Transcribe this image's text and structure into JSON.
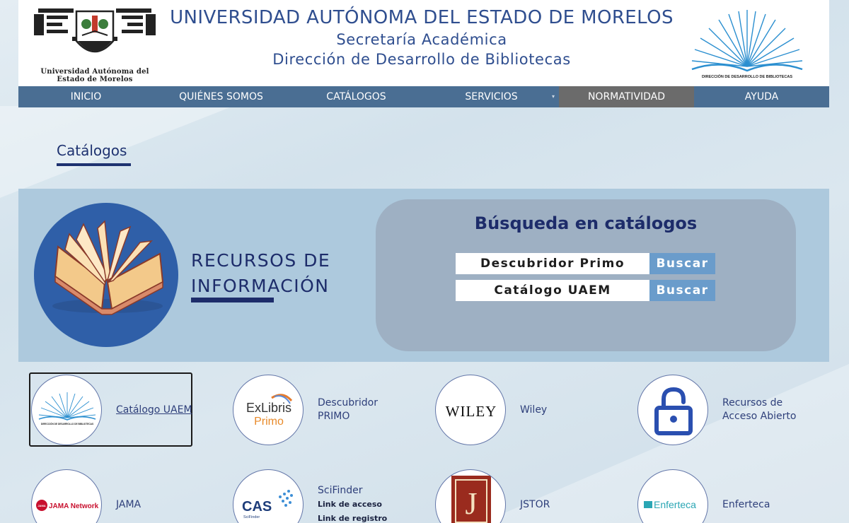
{
  "header": {
    "left_logo_text_line1": "Universidad Autónoma del",
    "left_logo_text_line2": "Estado de Morelos",
    "title": "UNIVERSIDAD AUTÓNOMA DEL ESTADO DE MORELOS",
    "subtitle1": "Secretaría Académica",
    "subtitle2": "Dirección de Desarrollo de Bibliotecas",
    "right_logo_text": "DIRECCIÓN DE DESARROLLO DE BIBLIOTECAS"
  },
  "nav": {
    "items": [
      {
        "label": "INICIO"
      },
      {
        "label": "QUIÉNES SOMOS"
      },
      {
        "label": "CATÁLOGOS"
      },
      {
        "label": "SERVICIOS"
      },
      {
        "label": "NORMATIVIDAD"
      },
      {
        "label": "AYUDA"
      }
    ],
    "active_index": 4,
    "caret": "▾"
  },
  "page": {
    "title": "Catálogos"
  },
  "banner": {
    "line1": "RECURSOS DE",
    "line2": "INFORMACIÓN",
    "search_title": "Búsqueda en catálogos",
    "rows": [
      {
        "field": "Descubridor Primo",
        "button": "Buscar"
      },
      {
        "field": "Catálogo UAEM",
        "button": "Buscar"
      }
    ]
  },
  "resources": {
    "catalogo": {
      "label": "Catálogo UAEM",
      "logo_text": "DIRECCIÓN DE DESARROLLO DE BIBLIOTECAS"
    },
    "primo": {
      "label1": "Descubridor",
      "label2": "PRIMO",
      "logo_line1": "ExLibris",
      "logo_line2": "Primo"
    },
    "wiley": {
      "label": "Wiley",
      "logo": "WILEY"
    },
    "abierto": {
      "label1": "Recursos de",
      "label2": "Acceso Abierto"
    },
    "jama": {
      "label": "JAMA",
      "logo": "JAMA Network",
      "logo_badge": "JAMA"
    },
    "scifinder": {
      "label": "SciFinder",
      "link1": "Link de acceso",
      "link2": "Link de registro",
      "logo": "CAS",
      "logo_sub": "SciFinder"
    },
    "jstor": {
      "label": "JSTOR",
      "logo_letter": "J"
    },
    "enferteca": {
      "label": "Enferteca",
      "logo": "Enferteca"
    }
  },
  "colors": {
    "nav_bg": "#4a6e93",
    "nav_active": "#6b6b6b",
    "banner_bg": "#adc9dd",
    "search_panel": "#9eb0c3",
    "button": "#6a9ccb",
    "title_blue": "#2f4e8f",
    "dark_blue": "#1d2c6a"
  }
}
